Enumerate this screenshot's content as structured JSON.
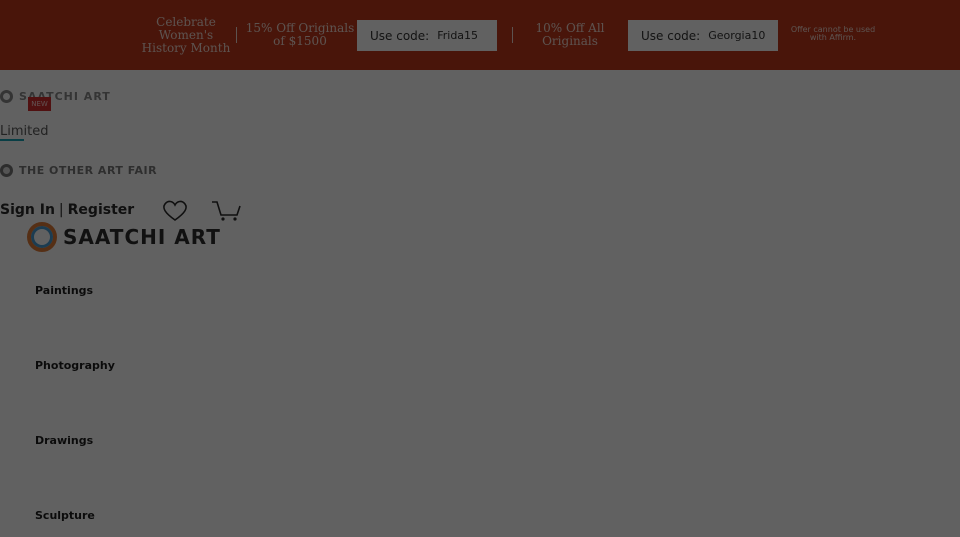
{
  "promo": {
    "headline": "Celebrate Women's History Month",
    "offer1": "15% Off Originals of $1500",
    "code1_label": "Use code:",
    "code1_value": "Frida15",
    "offer2": "10% Off All Originals",
    "code2_label": "Use code:",
    "code2_value": "Georgia10",
    "fine_print": "Offer cannot be used with Affirm."
  },
  "brands": {
    "saatchi_small": "SAATCHI ART",
    "new_badge": "NEW",
    "limited": "Limited",
    "other_fair": "THE OTHER ART FAIR"
  },
  "account": {
    "sign_in": "Sign In",
    "separator": "|",
    "register": "Register",
    "favorites_icon": "heart-icon",
    "cart_icon": "cart-icon"
  },
  "logo": {
    "text": "SAATCHI ART"
  },
  "categories": [
    "Paintings",
    "Photography",
    "Drawings",
    "Sculpture"
  ],
  "colors": {
    "promo_bg": "#c0391b",
    "overlay": "rgba(0,0,0,0.62)"
  }
}
